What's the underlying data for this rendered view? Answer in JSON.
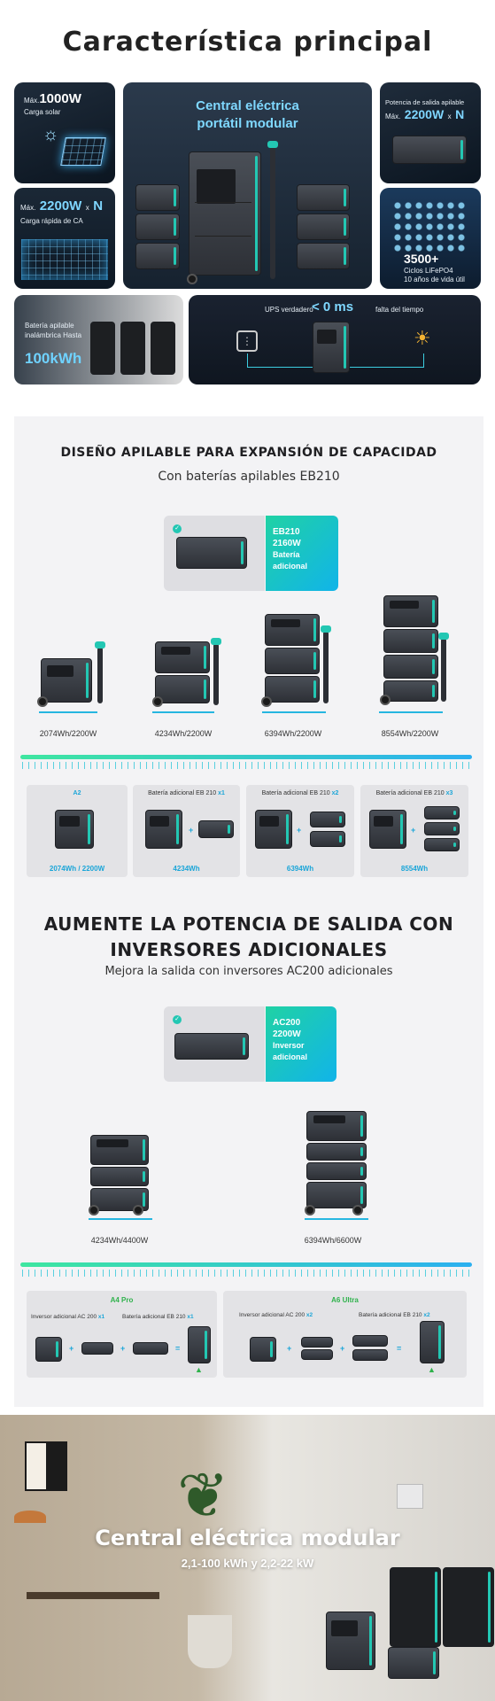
{
  "hero": {
    "title": "Característica principal",
    "solar": {
      "prefix": "Máx.",
      "value": "1000W",
      "label": "Carga solar"
    },
    "center": {
      "line1": "Central eléctrica",
      "line2": "portátil modular"
    },
    "stack_out": {
      "label": "Potencia de salida apilable",
      "prefix": "Máx.",
      "value": "2200W",
      "suffix": "x",
      "n": "N"
    },
    "ac": {
      "prefix": "Máx.",
      "value": "2200W",
      "suffix": "x",
      "n": "N",
      "label": "Carga rápida de CA"
    },
    "cycles": {
      "value": "3500+",
      "label": "Ciclos LiFePO4",
      "sub": "10 años de vida útil"
    },
    "battery": {
      "line1": "Batería apilable",
      "line2": "inalámbrica Hasta",
      "value": "100kWh"
    },
    "ups": {
      "label": "UPS verdadero",
      "value": "< 0 ms",
      "note": "falta del tiempo"
    }
  },
  "stack_section": {
    "title": "DISEÑO APILABLE PARA EXPANSIÓN DE CAPACIDAD",
    "subtitle": "Con baterías apilables EB210",
    "addon": {
      "l1": "EB210",
      "l2": "2160W",
      "l3": "Batería",
      "l4": "adicional"
    },
    "specs": [
      "2074Wh/2200W",
      "4234Wh/2200W",
      "6394Wh/2200W",
      "8554Wh/2200W"
    ],
    "combos": [
      {
        "top": "A2",
        "top_hl": "",
        "bottom": "2074Wh / 2200W"
      },
      {
        "top": "Batería adicional  EB 210",
        "top_hl": "x1",
        "bottom": "4234Wh"
      },
      {
        "top": "Batería adicional  EB 210",
        "top_hl": "x2",
        "bottom": "6394Wh"
      },
      {
        "top": "Batería adicional  EB 210",
        "top_hl": "x3",
        "bottom": "8554Wh"
      }
    ]
  },
  "inverter_section": {
    "title_l1": "AUMENTE LA POTENCIA DE SALIDA CON",
    "title_l2": "INVERSORES ADICIONALES",
    "subtitle": "Mejora la salida con inversores AC200 adicionales",
    "addon": {
      "l1": "AC200",
      "l2": "2200W",
      "l3": "Inversor",
      "l4": "adicional"
    },
    "specs": [
      "4234Wh/4400W",
      "6394Wh/6600W"
    ],
    "combos": [
      {
        "title": "A4 Pro",
        "left": "Inversor adicional  AC 200",
        "left_hl": "x1",
        "right": "Batería adicional  EB 210",
        "right_hl": "x1"
      },
      {
        "title": "A6 Ultra",
        "left": "Inversor adicional  AC 200",
        "left_hl": "x2",
        "right": "Batería adicional  EB 210",
        "right_hl": "x2"
      }
    ]
  },
  "photo": {
    "title": "Central eléctrica modular",
    "subtitle": "2,1-100 kWh y 2,2-22 kW"
  },
  "colors": {
    "accent_teal": "#23c7b3",
    "accent_blue": "#1aa5d8",
    "accent_green": "#2fb24c"
  }
}
